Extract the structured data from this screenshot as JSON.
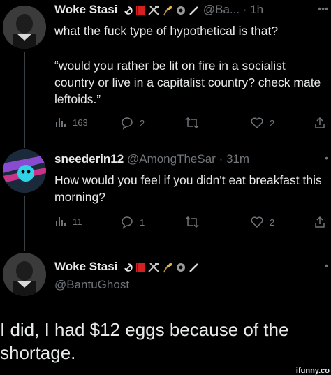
{
  "tweets": [
    {
      "name": "Woke Stasi",
      "handle": "@Ba...",
      "time": "· 1h",
      "reply_context": "what the fuck type of hypothetical is that?",
      "quote": "“would you rather be lit on fire in a socialist country or live in a capitalist country? check mate leftoids.”",
      "views": "163",
      "replies": "2",
      "retweets": "",
      "likes": "2"
    },
    {
      "name": "sneederin12",
      "handle": "@AmongTheSar",
      "time": "· 31m",
      "text": "How would you feel if you didn't eat breakfast this morning?",
      "views": "11",
      "replies": "1",
      "retweets": "",
      "likes": "2"
    },
    {
      "name": "Woke Stasi",
      "handle": "@BantuGhost"
    }
  ],
  "reply_text": "I did, I had $12 eggs because of the shortage.",
  "watermark": "ifunny.co",
  "colors": {
    "background": "#000000",
    "text": "#e7e9ea",
    "muted": "#71767b",
    "thread_line": "#3a3f44"
  },
  "icons": [
    "views-icon",
    "reply-icon",
    "retweet-icon",
    "like-icon",
    "share-icon",
    "more-icon"
  ]
}
